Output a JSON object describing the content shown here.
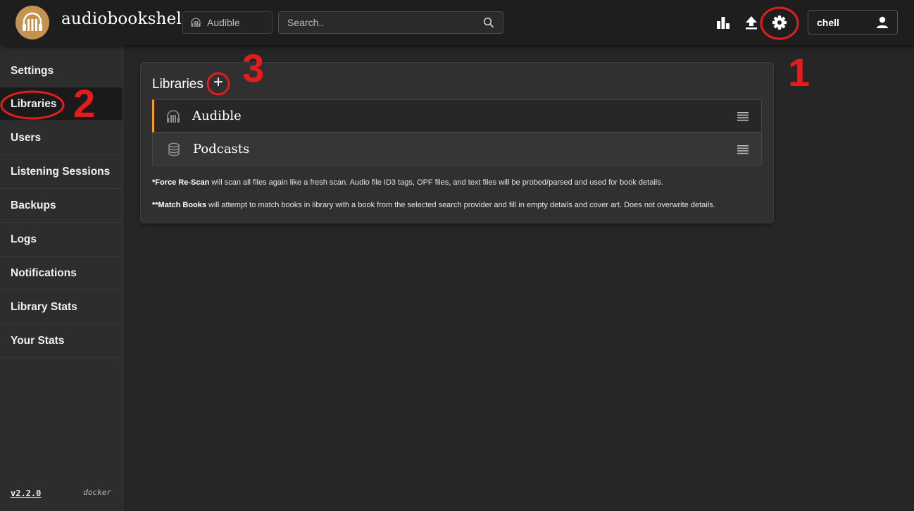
{
  "header": {
    "app_title": "audiobookshelf",
    "library_selector": "Audible",
    "search_placeholder": "Search..",
    "user_name": "chell",
    "icons": [
      "stats-icon",
      "upload-icon",
      "settings-icon",
      "user-icon"
    ]
  },
  "sidebar": {
    "items": [
      {
        "label": "Settings"
      },
      {
        "label": "Libraries",
        "active": true
      },
      {
        "label": "Users"
      },
      {
        "label": "Listening Sessions"
      },
      {
        "label": "Backups"
      },
      {
        "label": "Logs"
      },
      {
        "label": "Notifications"
      },
      {
        "label": "Library Stats"
      },
      {
        "label": "Your Stats"
      }
    ],
    "version": "v2.2.0",
    "environment": "docker"
  },
  "main": {
    "title": "Libraries",
    "add_symbol": "+",
    "libraries": [
      {
        "name": "Audible",
        "icon": "headphones-icon",
        "active": true
      },
      {
        "name": "Podcasts",
        "icon": "database-icon",
        "active": false
      }
    ],
    "note_rescan_label": "*Force Re-Scan",
    "note_rescan_text": " will scan all files again like a fresh scan. Audio file ID3 tags, OPF files, and text files will be probed/parsed and used for book details.",
    "note_match_label": "**Match Books",
    "note_match_text": " will attempt to match books in library with a book from the selected search provider and fill in empty details and cover art. Does not overwrite details."
  },
  "annotations": {
    "step1": "1",
    "step2": "2",
    "step3": "3",
    "color": "#e11d1d"
  },
  "colors": {
    "accent": "#f59e0b",
    "logo": "#c6924f",
    "background": "#262626"
  }
}
